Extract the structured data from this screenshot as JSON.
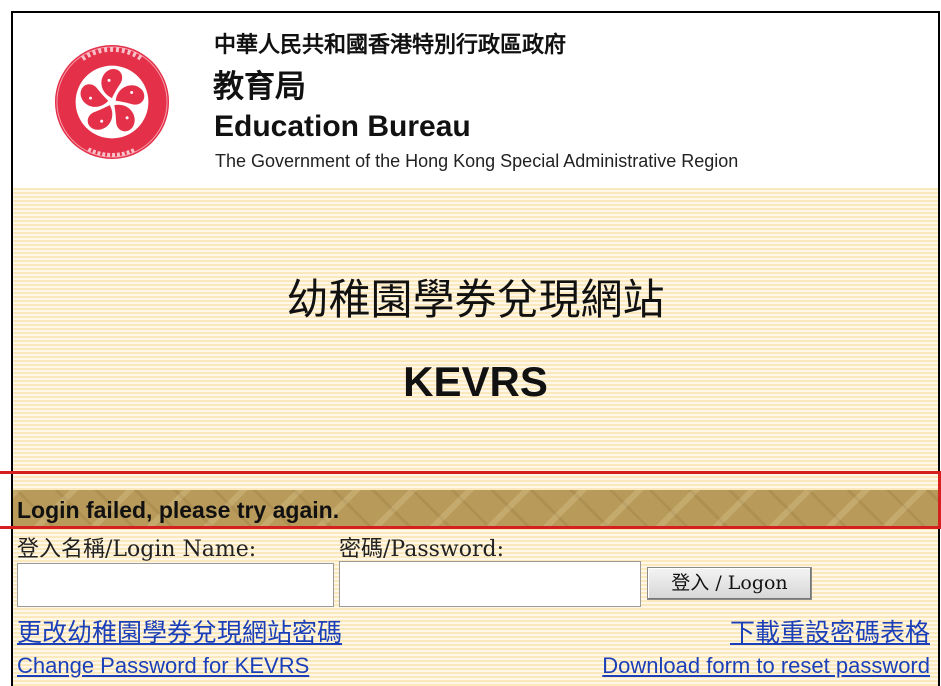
{
  "header": {
    "government_cn": "中華人民共和國香港特別行政區政府",
    "bureau_cn": "教育局",
    "bureau_en": "Education Bureau",
    "government_en": "The Government of the Hong Kong Special Administrative Region",
    "emblem_icon": "hksar-emblem-icon",
    "emblem_color": "#e5304a"
  },
  "site": {
    "title_cn": "幼稚園學券兌現網站",
    "title_en": "KEVRS"
  },
  "error": {
    "message": "Login failed, please try again.",
    "highlight_color": "#d62020"
  },
  "form": {
    "login_label": "登入名稱/Login Name:",
    "password_label": "密碼/Password:",
    "login_value": "",
    "password_value": "",
    "logon_button": "登入 / Logon"
  },
  "links": {
    "change_password_cn": "更改幼稚園學券兌現網站密碼",
    "download_form_cn": "下載重設密碼表格",
    "change_password_en": "Change Password for KEVRS",
    "download_form_en": "Download form to reset password"
  }
}
